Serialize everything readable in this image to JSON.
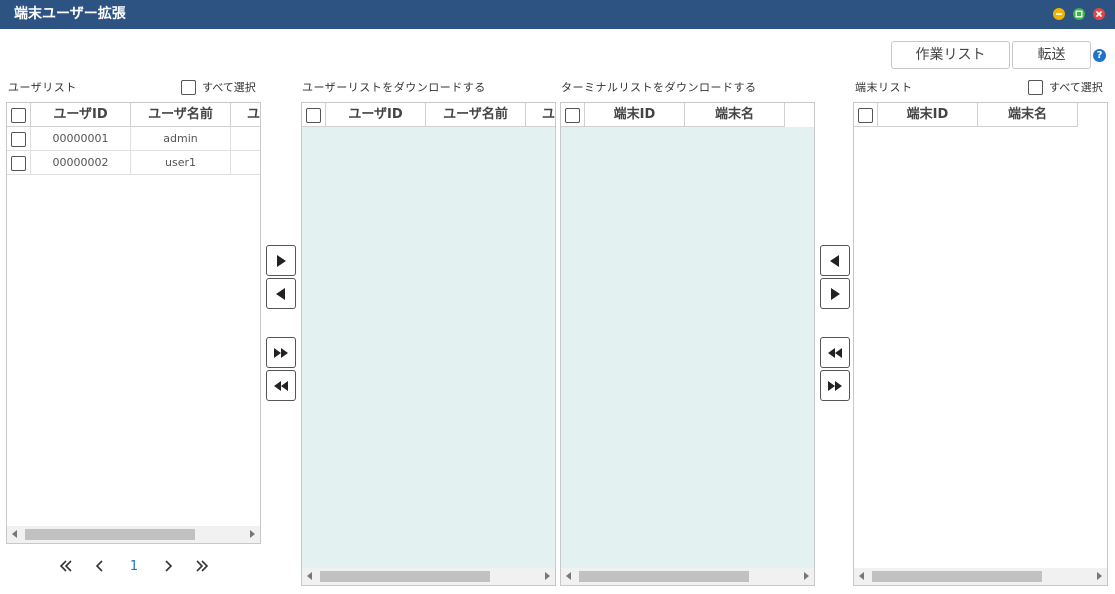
{
  "window": {
    "title": "端末ユーザー拡張",
    "controls": {
      "minimize_color": "#f0b400",
      "restore_color": "#3cb44b",
      "close_color": "#e04646"
    }
  },
  "toolbar": {
    "job_list_label": "作業リスト",
    "transfer_label": "転送",
    "help_glyph": "?"
  },
  "user_list": {
    "label": "ユーザリスト",
    "select_all_label": "すべて選択",
    "columns": [
      "ユーザID",
      "ユーザ名前",
      "ユ"
    ],
    "rows": [
      {
        "id": "00000001",
        "name": "admin"
      },
      {
        "id": "00000002",
        "name": "user1"
      }
    ],
    "pagination": {
      "current_page": "1"
    }
  },
  "download_user_list": {
    "label": "ユーザーリストをダウンロードする",
    "columns": [
      "ユーザID",
      "ユーザ名前",
      "ユ"
    ],
    "rows": []
  },
  "download_terminal_list": {
    "label": "ターミナルリストをダウンロードする",
    "columns": [
      "端末ID",
      "端末名"
    ],
    "rows": []
  },
  "terminal_list": {
    "label": "端末リスト",
    "select_all_label": "すべて選択",
    "columns": [
      "端末ID",
      "端末名"
    ],
    "rows": []
  },
  "icons": {
    "move_right": "play-right-icon",
    "move_left": "play-left-icon",
    "move_all_right": "fast-forward-icon",
    "move_all_left": "fast-rewind-icon",
    "first_page": "double-chevron-left-icon",
    "prev_page": "chevron-left-icon",
    "next_page": "chevron-right-icon",
    "last_page": "double-chevron-right-icon"
  },
  "colors": {
    "titlebar": "#2d5382",
    "transfer_panel_bg": "#e3f1f1",
    "accent": "#1e74c8"
  }
}
